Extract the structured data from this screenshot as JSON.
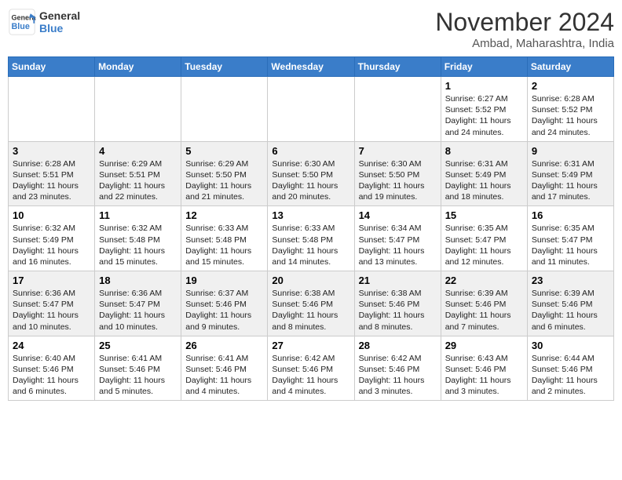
{
  "header": {
    "logo_line1": "General",
    "logo_line2": "Blue",
    "month": "November 2024",
    "location": "Ambad, Maharashtra, India"
  },
  "days_of_week": [
    "Sunday",
    "Monday",
    "Tuesday",
    "Wednesday",
    "Thursday",
    "Friday",
    "Saturday"
  ],
  "weeks": [
    [
      {
        "day": "",
        "info": ""
      },
      {
        "day": "",
        "info": ""
      },
      {
        "day": "",
        "info": ""
      },
      {
        "day": "",
        "info": ""
      },
      {
        "day": "",
        "info": ""
      },
      {
        "day": "1",
        "info": "Sunrise: 6:27 AM\nSunset: 5:52 PM\nDaylight: 11 hours and 24 minutes."
      },
      {
        "day": "2",
        "info": "Sunrise: 6:28 AM\nSunset: 5:52 PM\nDaylight: 11 hours and 24 minutes."
      }
    ],
    [
      {
        "day": "3",
        "info": "Sunrise: 6:28 AM\nSunset: 5:51 PM\nDaylight: 11 hours and 23 minutes."
      },
      {
        "day": "4",
        "info": "Sunrise: 6:29 AM\nSunset: 5:51 PM\nDaylight: 11 hours and 22 minutes."
      },
      {
        "day": "5",
        "info": "Sunrise: 6:29 AM\nSunset: 5:50 PM\nDaylight: 11 hours and 21 minutes."
      },
      {
        "day": "6",
        "info": "Sunrise: 6:30 AM\nSunset: 5:50 PM\nDaylight: 11 hours and 20 minutes."
      },
      {
        "day": "7",
        "info": "Sunrise: 6:30 AM\nSunset: 5:50 PM\nDaylight: 11 hours and 19 minutes."
      },
      {
        "day": "8",
        "info": "Sunrise: 6:31 AM\nSunset: 5:49 PM\nDaylight: 11 hours and 18 minutes."
      },
      {
        "day": "9",
        "info": "Sunrise: 6:31 AM\nSunset: 5:49 PM\nDaylight: 11 hours and 17 minutes."
      }
    ],
    [
      {
        "day": "10",
        "info": "Sunrise: 6:32 AM\nSunset: 5:49 PM\nDaylight: 11 hours and 16 minutes."
      },
      {
        "day": "11",
        "info": "Sunrise: 6:32 AM\nSunset: 5:48 PM\nDaylight: 11 hours and 15 minutes."
      },
      {
        "day": "12",
        "info": "Sunrise: 6:33 AM\nSunset: 5:48 PM\nDaylight: 11 hours and 15 minutes."
      },
      {
        "day": "13",
        "info": "Sunrise: 6:33 AM\nSunset: 5:48 PM\nDaylight: 11 hours and 14 minutes."
      },
      {
        "day": "14",
        "info": "Sunrise: 6:34 AM\nSunset: 5:47 PM\nDaylight: 11 hours and 13 minutes."
      },
      {
        "day": "15",
        "info": "Sunrise: 6:35 AM\nSunset: 5:47 PM\nDaylight: 11 hours and 12 minutes."
      },
      {
        "day": "16",
        "info": "Sunrise: 6:35 AM\nSunset: 5:47 PM\nDaylight: 11 hours and 11 minutes."
      }
    ],
    [
      {
        "day": "17",
        "info": "Sunrise: 6:36 AM\nSunset: 5:47 PM\nDaylight: 11 hours and 10 minutes."
      },
      {
        "day": "18",
        "info": "Sunrise: 6:36 AM\nSunset: 5:47 PM\nDaylight: 11 hours and 10 minutes."
      },
      {
        "day": "19",
        "info": "Sunrise: 6:37 AM\nSunset: 5:46 PM\nDaylight: 11 hours and 9 minutes."
      },
      {
        "day": "20",
        "info": "Sunrise: 6:38 AM\nSunset: 5:46 PM\nDaylight: 11 hours and 8 minutes."
      },
      {
        "day": "21",
        "info": "Sunrise: 6:38 AM\nSunset: 5:46 PM\nDaylight: 11 hours and 8 minutes."
      },
      {
        "day": "22",
        "info": "Sunrise: 6:39 AM\nSunset: 5:46 PM\nDaylight: 11 hours and 7 minutes."
      },
      {
        "day": "23",
        "info": "Sunrise: 6:39 AM\nSunset: 5:46 PM\nDaylight: 11 hours and 6 minutes."
      }
    ],
    [
      {
        "day": "24",
        "info": "Sunrise: 6:40 AM\nSunset: 5:46 PM\nDaylight: 11 hours and 6 minutes."
      },
      {
        "day": "25",
        "info": "Sunrise: 6:41 AM\nSunset: 5:46 PM\nDaylight: 11 hours and 5 minutes."
      },
      {
        "day": "26",
        "info": "Sunrise: 6:41 AM\nSunset: 5:46 PM\nDaylight: 11 hours and 4 minutes."
      },
      {
        "day": "27",
        "info": "Sunrise: 6:42 AM\nSunset: 5:46 PM\nDaylight: 11 hours and 4 minutes."
      },
      {
        "day": "28",
        "info": "Sunrise: 6:42 AM\nSunset: 5:46 PM\nDaylight: 11 hours and 3 minutes."
      },
      {
        "day": "29",
        "info": "Sunrise: 6:43 AM\nSunset: 5:46 PM\nDaylight: 11 hours and 3 minutes."
      },
      {
        "day": "30",
        "info": "Sunrise: 6:44 AM\nSunset: 5:46 PM\nDaylight: 11 hours and 2 minutes."
      }
    ]
  ]
}
